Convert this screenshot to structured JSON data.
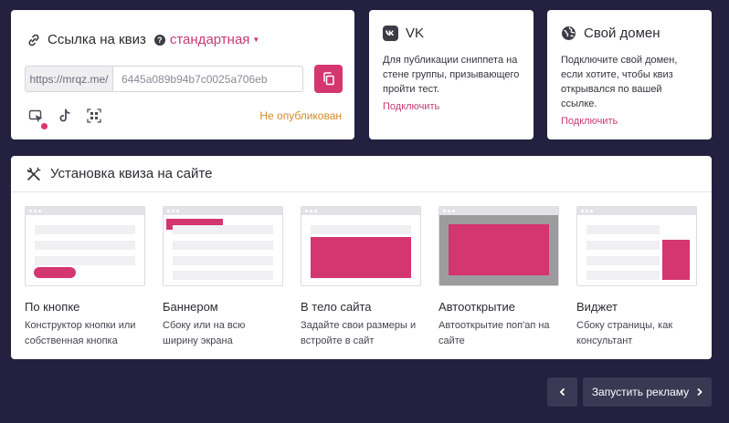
{
  "link_card": {
    "title": "Ссылка на квиз",
    "mode": "стандартная",
    "url_prefix": "https://mrqz.me/",
    "quiz_id": "6445a089b94b7c0025a706eb",
    "status": "Не опубликован"
  },
  "vk_card": {
    "title": "VK",
    "text": "Для публикации сниппета на стене группы, призывающего пройти тест.",
    "link": "Подключить"
  },
  "domain_card": {
    "title": "Свой домен",
    "text": "Подключите свой домен, если хотите, чтобы квиз открывался по вашей ссылке.",
    "link": "Подключить"
  },
  "install": {
    "title": "Установка квиза на сайте",
    "options": [
      {
        "title": "По кнопке",
        "desc": "Конструктор кнопки или собственная кнопка"
      },
      {
        "title": "Баннером",
        "desc": "Сбоку или на всю ширину экрана"
      },
      {
        "title": "В тело сайта",
        "desc": "Задайте свои размеры и встройте в сайт"
      },
      {
        "title": "Автооткрытие",
        "desc": "Автооткрытие поп'ап на сайте"
      },
      {
        "title": "Виджет",
        "desc": "Сбоку страницы, как консультант"
      }
    ]
  },
  "footer": {
    "launch_label": "Запустить рекламу"
  },
  "colors": {
    "accent": "#d4366f",
    "background": "#23213f",
    "warning": "#d28a2a"
  }
}
